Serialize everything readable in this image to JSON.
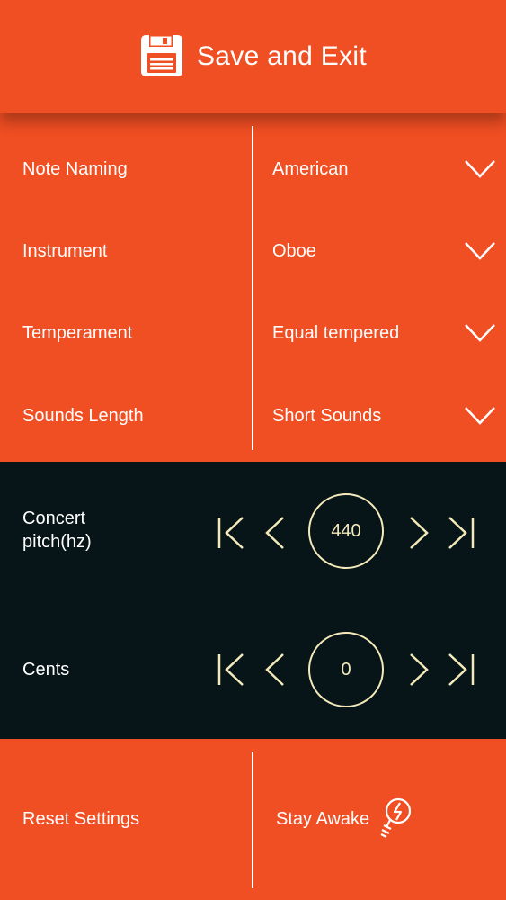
{
  "header": {
    "title": "Save and Exit",
    "icon": "floppy-disk-icon"
  },
  "settings": [
    {
      "label": "Note Naming",
      "value": "American"
    },
    {
      "label": "Instrument",
      "value": "Oboe"
    },
    {
      "label": "Temperament",
      "value": "Equal tempered"
    },
    {
      "label": "Sounds Length",
      "value": "Short Sounds"
    }
  ],
  "concert_pitch": {
    "label": "Concert pitch(hz)",
    "value": "440"
  },
  "cents": {
    "label": "Cents",
    "value": "0"
  },
  "bottom": {
    "reset_label": "Reset Settings",
    "stay_awake_label": "Stay Awake"
  },
  "colors": {
    "accent": "#F04E23",
    "dark_panel": "#071418",
    "control_cream": "#F3E9B9"
  }
}
